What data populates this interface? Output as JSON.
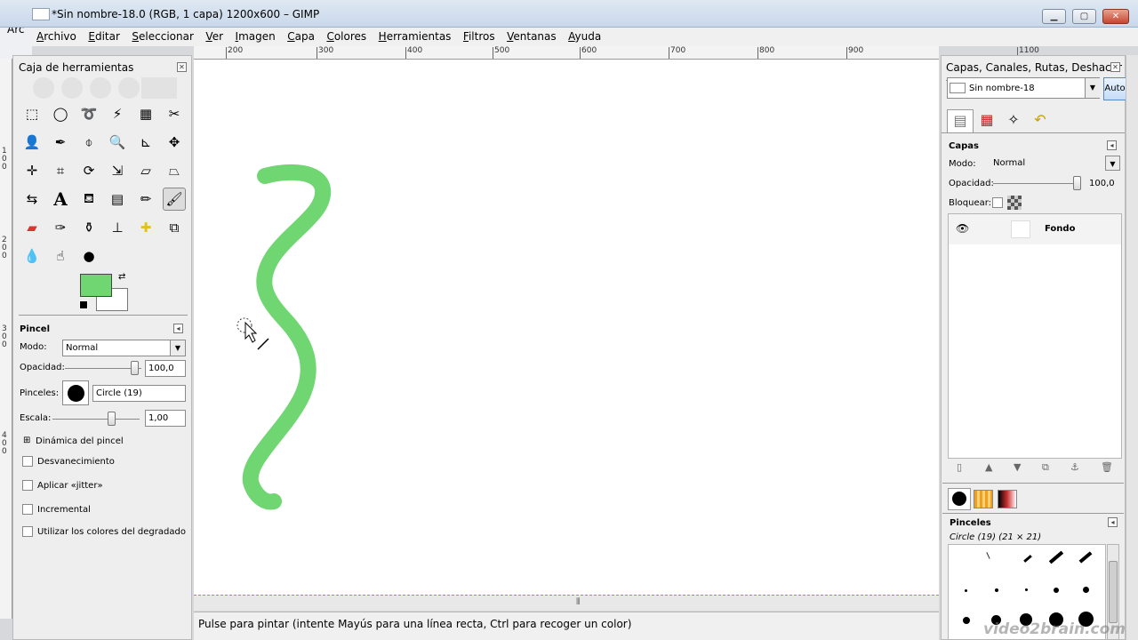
{
  "window": {
    "title": "*Sin nombre-18.0 (RGB, 1 capa) 1200x600 – GIMP",
    "bg_window_menu": "Arc"
  },
  "menu": [
    "Archivo",
    "Editar",
    "Seleccionar",
    "Ver",
    "Imagen",
    "Capa",
    "Colores",
    "Herramientas",
    "Filtros",
    "Ventanas",
    "Ayuda"
  ],
  "ruler": {
    "ticks": [
      "200",
      "300",
      "400",
      "500",
      "600",
      "700",
      "800",
      "900",
      "1100"
    ],
    "vticks": [
      "100",
      "200",
      "300",
      "400"
    ]
  },
  "toolbox": {
    "title": "Caja de herramientas",
    "colors": {
      "foreground": "#6fd672",
      "background": "#ffffff"
    },
    "options": {
      "title": "Pincel",
      "mode_label": "Modo:",
      "mode_value": "Normal",
      "opacity_label": "Opacidad:",
      "opacity_value": "100,0",
      "brushes_label": "Pinceles:",
      "brush_name": "Circle (19)",
      "scale_label": "Escala:",
      "scale_value": "1,00",
      "dynamics_label": "Dinámica del pincel",
      "fade_label": "Desvanecimiento",
      "jitter_label": "Aplicar «jitter»",
      "incremental_label": "Incremental",
      "gradient_label": "Utilizar los colores del degradado"
    }
  },
  "status": {
    "text": "Pulse para pintar (intente Mayús para una línea recta, Ctrl para recoger un color)"
  },
  "dock": {
    "title": "Capas, Canales, Rutas, Deshacer - ...",
    "image_name": "Sin nombre-18",
    "auto_label": "Auto",
    "layers": {
      "title": "Capas",
      "mode_label": "Modo:",
      "mode_value": "Normal",
      "opacity_label": "Opacidad:",
      "opacity_value": "100,0",
      "lock_label": "Bloquear:",
      "layer_name": "Fondo"
    },
    "brushes": {
      "title": "Pinceles",
      "selected": "Circle (19) (21 × 21)"
    }
  },
  "watermark": "video2brain.com"
}
